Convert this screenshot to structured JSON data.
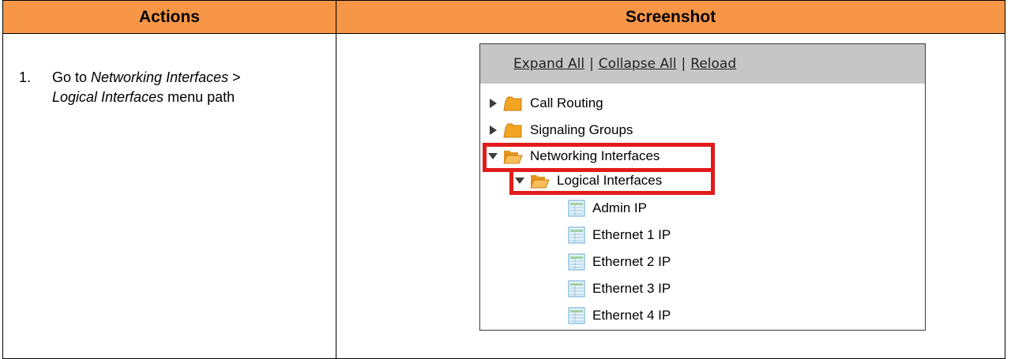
{
  "table": {
    "header_actions": "Actions",
    "header_screenshot": "Screenshot",
    "step_number": "1.",
    "step_prefix": "Go to ",
    "step_path_1": "Networking Interfaces",
    "step_sep": " >",
    "step_path_2": "Logical Interfaces",
    "step_suffix": " menu path"
  },
  "tree": {
    "expand_all": "Expand All",
    "collapse_all": "Collapse All",
    "reload": "Reload",
    "separator": "|",
    "nodes": [
      {
        "label": "Call Routing",
        "type": "folder",
        "state": "collapsed"
      },
      {
        "label": "Signaling Groups",
        "type": "folder",
        "state": "collapsed"
      },
      {
        "label": "Networking Interfaces",
        "type": "folder",
        "state": "expanded"
      },
      {
        "label": "Logical Interfaces",
        "type": "folder",
        "state": "expanded"
      },
      {
        "label": "Admin IP",
        "type": "page"
      },
      {
        "label": "Ethernet 1 IP",
        "type": "page"
      },
      {
        "label": "Ethernet 2 IP",
        "type": "page"
      },
      {
        "label": "Ethernet 3 IP",
        "type": "page"
      },
      {
        "label": "Ethernet 4 IP",
        "type": "page"
      }
    ]
  },
  "colors": {
    "header_bg": "#f79646",
    "highlight": "#e31b1b",
    "tree_header_bg": "#c6c6c6",
    "folder": "#f2a422"
  }
}
